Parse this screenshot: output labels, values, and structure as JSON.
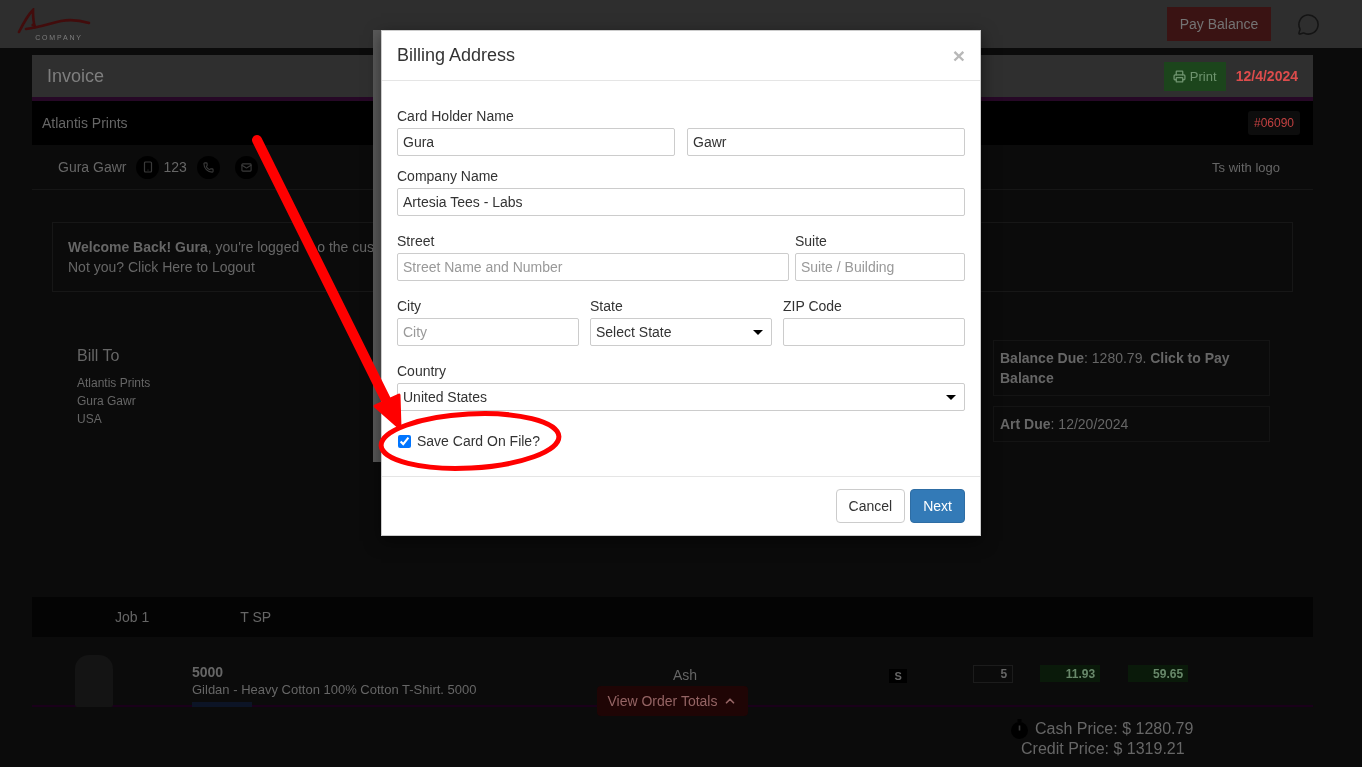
{
  "header": {
    "logo_text": "COMPANY",
    "pay_balance_button": "Pay Balance"
  },
  "invoice_bar": {
    "title": "Invoice",
    "print_button": "Print",
    "date": "12/4/2024"
  },
  "company_bar": {
    "name": "Atlantis Prints",
    "order_number": "#06090"
  },
  "contact": {
    "name": "Gura Gawr",
    "mobile": "123",
    "project": "Ts with logo"
  },
  "welcome": {
    "message": "**Welcome Back! Gura**, you're logged",
    "message_continued": "o the cus",
    "logout_link": "Not you? Click Here to Logout"
  },
  "bill_to": {
    "title": "Bill To",
    "lines": [
      "Atlantis Prints",
      "Gura Gawr",
      "USA"
    ]
  },
  "notices": [
    {
      "text": "**Balance Due**: 1280.79. **Click to Pay Balance**"
    },
    {
      "text": "**Art Due**: 12/20/2024"
    }
  ],
  "job_bar": {
    "title": "Job 1",
    "column_2": "T SP"
  },
  "line_item": {
    "style_number": "5000",
    "description": "Gildan - Heavy Cotton 100% Cotton T-Shirt. 5000",
    "garment_color": "Ash",
    "size": "S",
    "quantity": "5",
    "unit_price": "11.93",
    "total": "59.65"
  },
  "order_totals_button": "View Order Totals",
  "totals": {
    "cash_price": "Cash Price: $ 1280.79",
    "credit_price": "Credit Price: $ 1319.21"
  },
  "modal": {
    "title": "Billing Address",
    "close": "×",
    "rows": [
      {
        "fields": [
          {
            "label": "Card Holder Name",
            "kind": "text",
            "value": "Gura"
          },
          {
            "kind": "text",
            "value": "Gawr"
          }
        ]
      },
      {
        "fields": [
          {
            "label": "Company Name",
            "kind": "text",
            "value": "Artesia Tees - Labs"
          }
        ]
      },
      {
        "fields": [
          {
            "label": "Street",
            "kind": "text",
            "placeholder": "Street Name and Number"
          },
          {
            "label": "Suite",
            "kind": "text",
            "placeholder": "Suite / Building"
          }
        ]
      },
      {
        "fields": [
          {
            "label": "City",
            "kind": "text",
            "placeholder": "City"
          },
          {
            "label": "State",
            "kind": "select",
            "value": "Select State"
          },
          {
            "label": "ZIP Code",
            "kind": "text"
          }
        ]
      },
      {
        "fields": [
          {
            "label": "Country",
            "kind": "select",
            "value": "United States"
          }
        ]
      }
    ],
    "save_card": {
      "label": "Save Card On File?",
      "checked": true
    },
    "buttons": [
      {
        "label": "Cancel",
        "kind": "default"
      },
      {
        "label": "Next",
        "kind": "primary"
      }
    ]
  }
}
